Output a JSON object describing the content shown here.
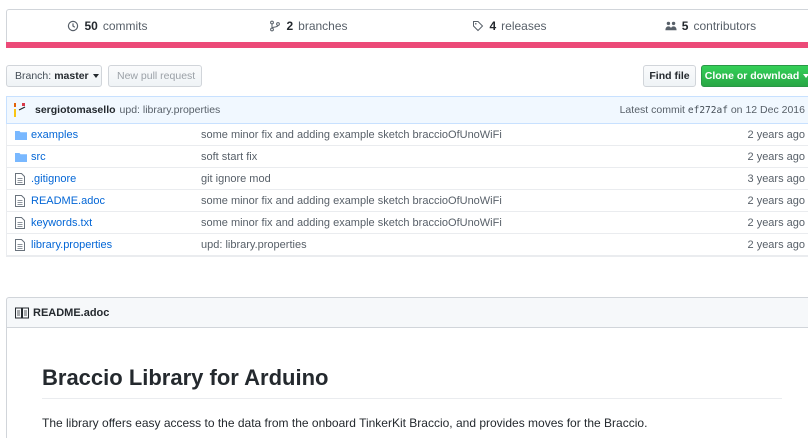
{
  "stats": {
    "commits_count": "50",
    "commits_label": "commits",
    "branches_count": "2",
    "branches_label": "branches",
    "releases_count": "4",
    "releases_label": "releases",
    "contributors_count": "5",
    "contributors_label": "contributors"
  },
  "language_color": "#ec4a78",
  "toolbar": {
    "branch_prefix": "Branch:",
    "branch_name": "master",
    "new_pr_label": "New pull request",
    "find_file_label": "Find file",
    "clone_label": "Clone or download"
  },
  "commit": {
    "author": "sergiotomasello",
    "message": "upd: library.properties",
    "latest_prefix": "Latest commit",
    "sha": "ef272af",
    "date": "on 12 Dec 2016"
  },
  "files": [
    {
      "type": "folder-icon",
      "name": "examples",
      "message": "some minor fix and adding example sketch braccioOfUnoWiFi",
      "age": "2 years ago"
    },
    {
      "type": "folder-icon",
      "name": "src",
      "message": "soft start fix",
      "age": "2 years ago"
    },
    {
      "type": "file-icon",
      "name": ".gitignore",
      "message": "git ignore mod",
      "age": "3 years ago"
    },
    {
      "type": "file-icon",
      "name": "README.adoc",
      "message": "some minor fix and adding example sketch braccioOfUnoWiFi",
      "age": "2 years ago"
    },
    {
      "type": "file-icon",
      "name": "keywords.txt",
      "message": "some minor fix and adding example sketch braccioOfUnoWiFi",
      "age": "2 years ago"
    },
    {
      "type": "file-icon",
      "name": "library.properties",
      "message": "upd: library.properties",
      "age": "2 years ago"
    }
  ],
  "readme": {
    "header": "README.adoc",
    "title": "Braccio Library for Arduino",
    "intro": "The library offers easy access to the data from the onboard TinkerKit Braccio, and provides moves for the Braccio."
  }
}
